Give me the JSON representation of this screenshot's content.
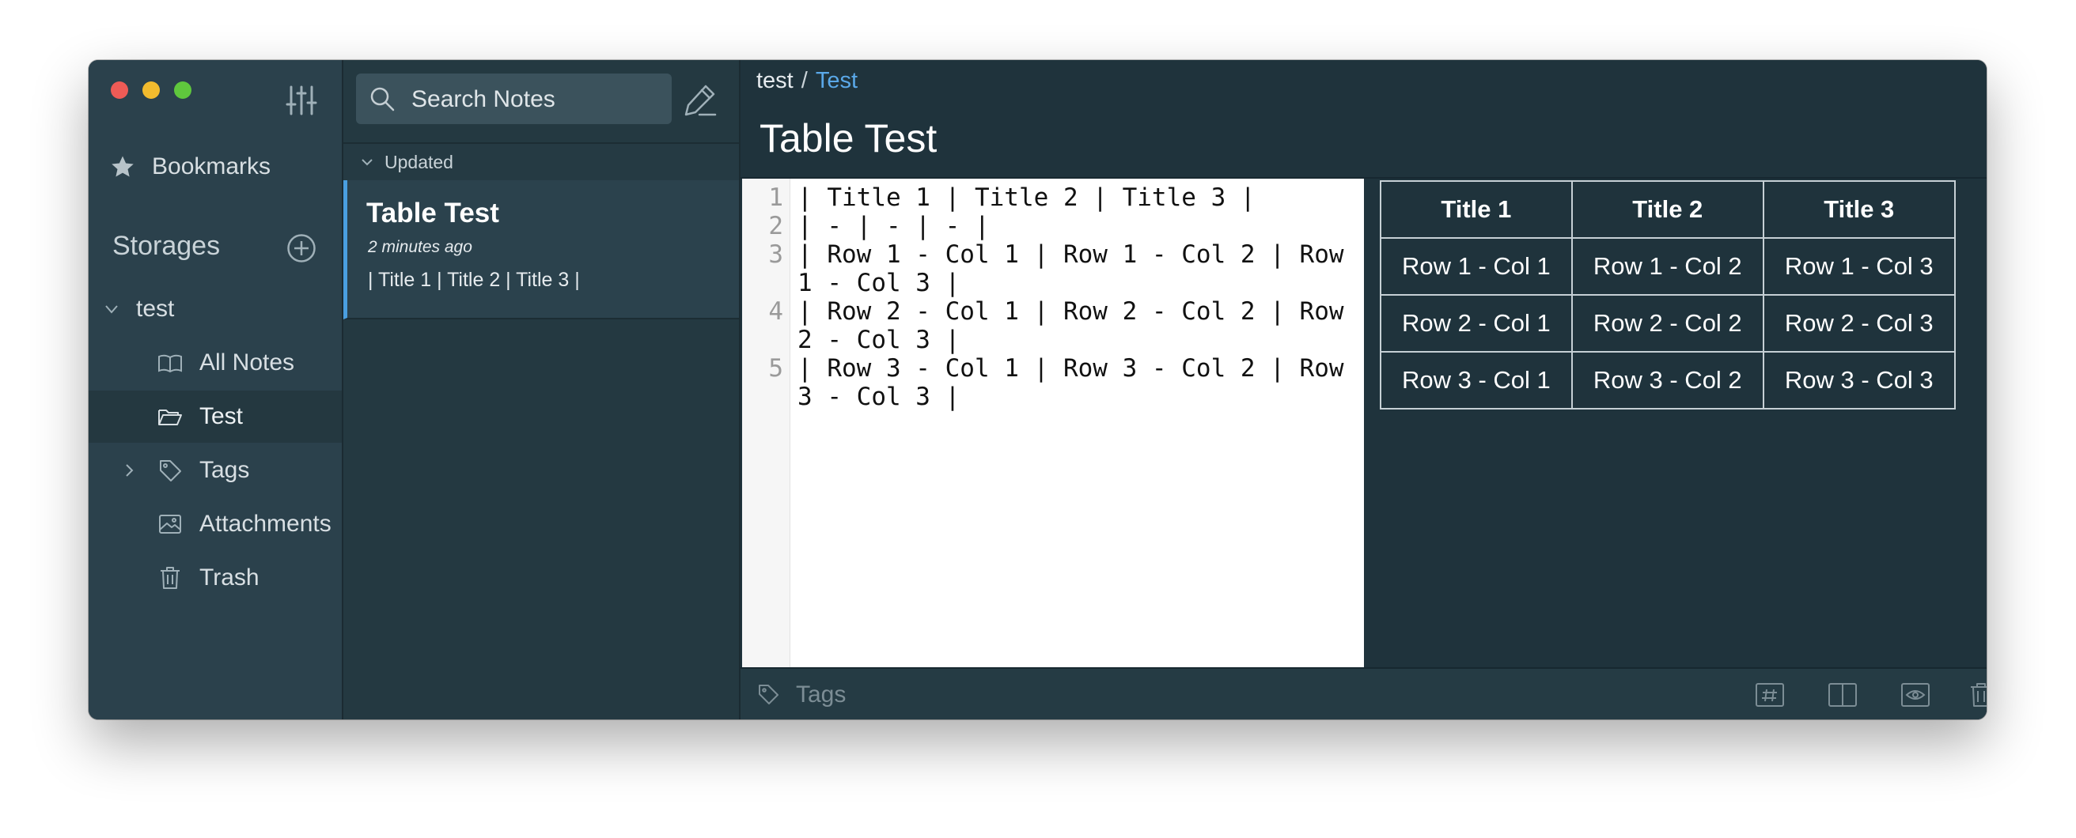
{
  "sidebar": {
    "bookmarks_label": "Bookmarks",
    "storages_title": "Storages",
    "storage_name": "test",
    "items": [
      {
        "label": "All Notes",
        "icon": "book-icon"
      },
      {
        "label": "Test",
        "icon": "folder-open-icon"
      },
      {
        "label": "Tags",
        "icon": "tag-icon"
      },
      {
        "label": "Attachments",
        "icon": "image-icon"
      },
      {
        "label": "Trash",
        "icon": "trash-icon"
      }
    ]
  },
  "notelist": {
    "search_placeholder": "Search Notes",
    "sort_label": "Updated",
    "notes": [
      {
        "title": "Table Test",
        "time": "2 minutes ago",
        "snippet": "| Title 1 | Title 2 | Title 3 |"
      }
    ]
  },
  "main": {
    "breadcrumb": {
      "storage": "test",
      "separator": "/",
      "folder": "Test"
    },
    "title": "Table Test",
    "editor_lines": [
      {
        "num": "1",
        "text": "| Title 1 | Title 2 | Title 3 |"
      },
      {
        "num": "2",
        "text": "| - | - | - |"
      },
      {
        "num": "3",
        "text": "| Row 1 - Col 1 | Row 1 - Col 2 | Row 1 - Col 3 |"
      },
      {
        "num": "4",
        "text": "| Row 2 - Col 1 | Row 2 - Col 2 | Row 2 - Col 3 |"
      },
      {
        "num": "5",
        "text": "| Row 3 - Col 1 | Row 3 - Col 2 | Row 3 - Col 3 |"
      }
    ],
    "preview_table": {
      "headers": [
        "Title 1",
        "Title 2",
        "Title 3"
      ],
      "rows": [
        [
          "Row 1 - Col 1",
          "Row 1 - Col 2",
          "Row 1 - Col 3"
        ],
        [
          "Row 2 - Col 1",
          "Row 2 - Col 2",
          "Row 2 - Col 3"
        ],
        [
          "Row 3 - Col 1",
          "Row 3 - Col 2",
          "Row 3 - Col 3"
        ]
      ]
    },
    "bottombar": {
      "tags_placeholder": "Tags"
    }
  },
  "colors": {
    "sidebar_bg": "#2b414c",
    "notelist_bg": "#243941",
    "main_bg": "#1f333c",
    "accent": "#4a9fe0",
    "link": "#5aa8e8"
  }
}
